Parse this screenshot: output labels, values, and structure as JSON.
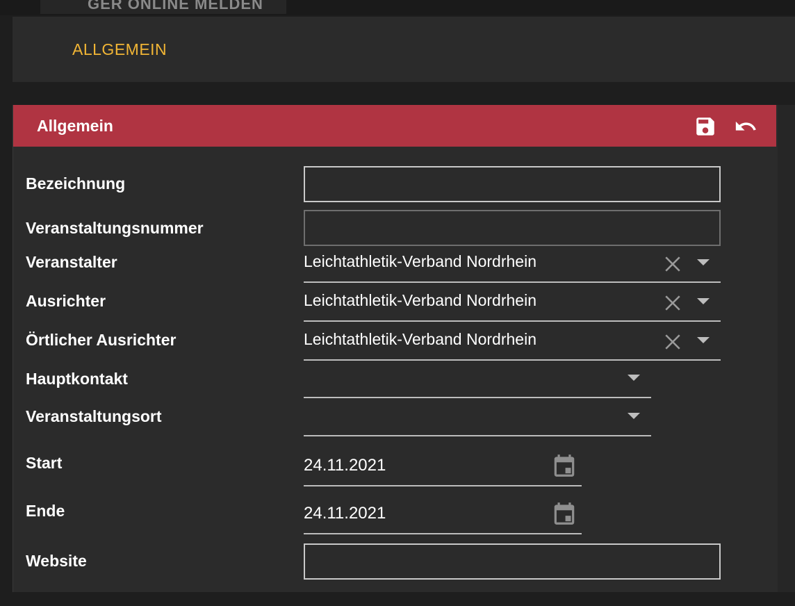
{
  "top_button": {
    "label": "GER ONLINE MELDEN"
  },
  "tabs": [
    {
      "label": "ALLGEMEIN"
    }
  ],
  "colors": {
    "accent": "#f1b535",
    "header": "#b03442",
    "panel": "#2b2b2b"
  },
  "panel": {
    "title": "Allgemein",
    "actions": [
      {
        "icon": "save-icon"
      },
      {
        "icon": "undo-icon"
      }
    ]
  },
  "form": {
    "bezeichnung": {
      "label": "Bezeichnung",
      "value": ""
    },
    "veranstaltungsnummer": {
      "label": "Veranstaltungsnummer",
      "value": ""
    },
    "veranstalter": {
      "label": "Veranstalter",
      "value": "Leichtathletik-Verband Nordrhein"
    },
    "ausrichter": {
      "label": "Ausrichter",
      "value": "Leichtathletik-Verband Nordrhein"
    },
    "oertlicher_ausrichter": {
      "label": "Örtlicher Ausrichter",
      "value": "Leichtathletik-Verband Nordrhein"
    },
    "hauptkontakt": {
      "label": "Hauptkontakt",
      "value": ""
    },
    "veranstaltungsort": {
      "label": "Veranstaltungsort",
      "value": ""
    },
    "start": {
      "label": "Start",
      "value": "24.11.2021"
    },
    "ende": {
      "label": "Ende",
      "value": "24.11.2021"
    },
    "website": {
      "label": "Website",
      "value": ""
    }
  }
}
